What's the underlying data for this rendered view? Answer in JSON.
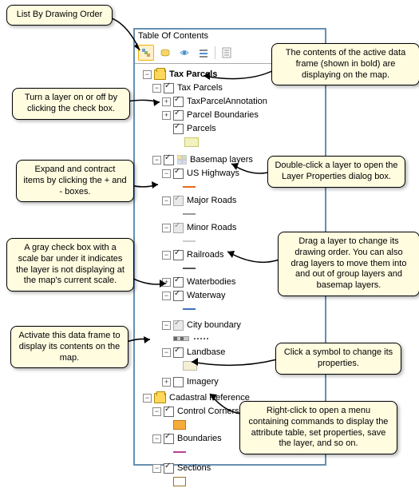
{
  "panel": {
    "title": "Table Of Contents"
  },
  "dataframes": {
    "tax_parcels": {
      "name": "Tax Parcels",
      "layers": {
        "tax_parcels_group": "Tax Parcels",
        "tpa": "TaxParcelAnnotation",
        "pboundaries": "Parcel Boundaries",
        "parcels": "Parcels",
        "basemap": "Basemap layers",
        "ushwy": "US Highways",
        "major": "Major Roads",
        "minor": "Minor Roads",
        "rail": "Railroads",
        "water": "Waterbodies",
        "waterway": "Waterway",
        "city": "City boundary",
        "landbase": "Landbase",
        "imagery": "Imagery"
      }
    },
    "cadastral": {
      "name": "Cadastral Reference",
      "layers": {
        "corners": "Control Corners",
        "boundaries": "Boundaries",
        "sections": "Sections"
      }
    }
  },
  "callouts": {
    "c1": "List By Drawing Order",
    "c2": "The contents of the active data frame (shown in bold) are displaying on the map.",
    "c3": "Turn a layer on or off by clicking the check box.",
    "c4": "Double-click a layer to open the Layer Properties dialog box.",
    "c5": "Expand and contract items by clicking the + and - boxes.",
    "c6": "Drag a layer to change its drawing order. You can also drag layers to move them into and out of group layers and basemap layers.",
    "c7": "A gray check box with a scale bar under it indicates the layer is not displaying at the map's current scale.",
    "c8": "Activate this data frame to display its contents on the map.",
    "c9": "Click a symbol to change its properties.",
    "c10": "Right-click to open a menu containing commands to display the attribute table, set properties, save the layer, and so on."
  }
}
